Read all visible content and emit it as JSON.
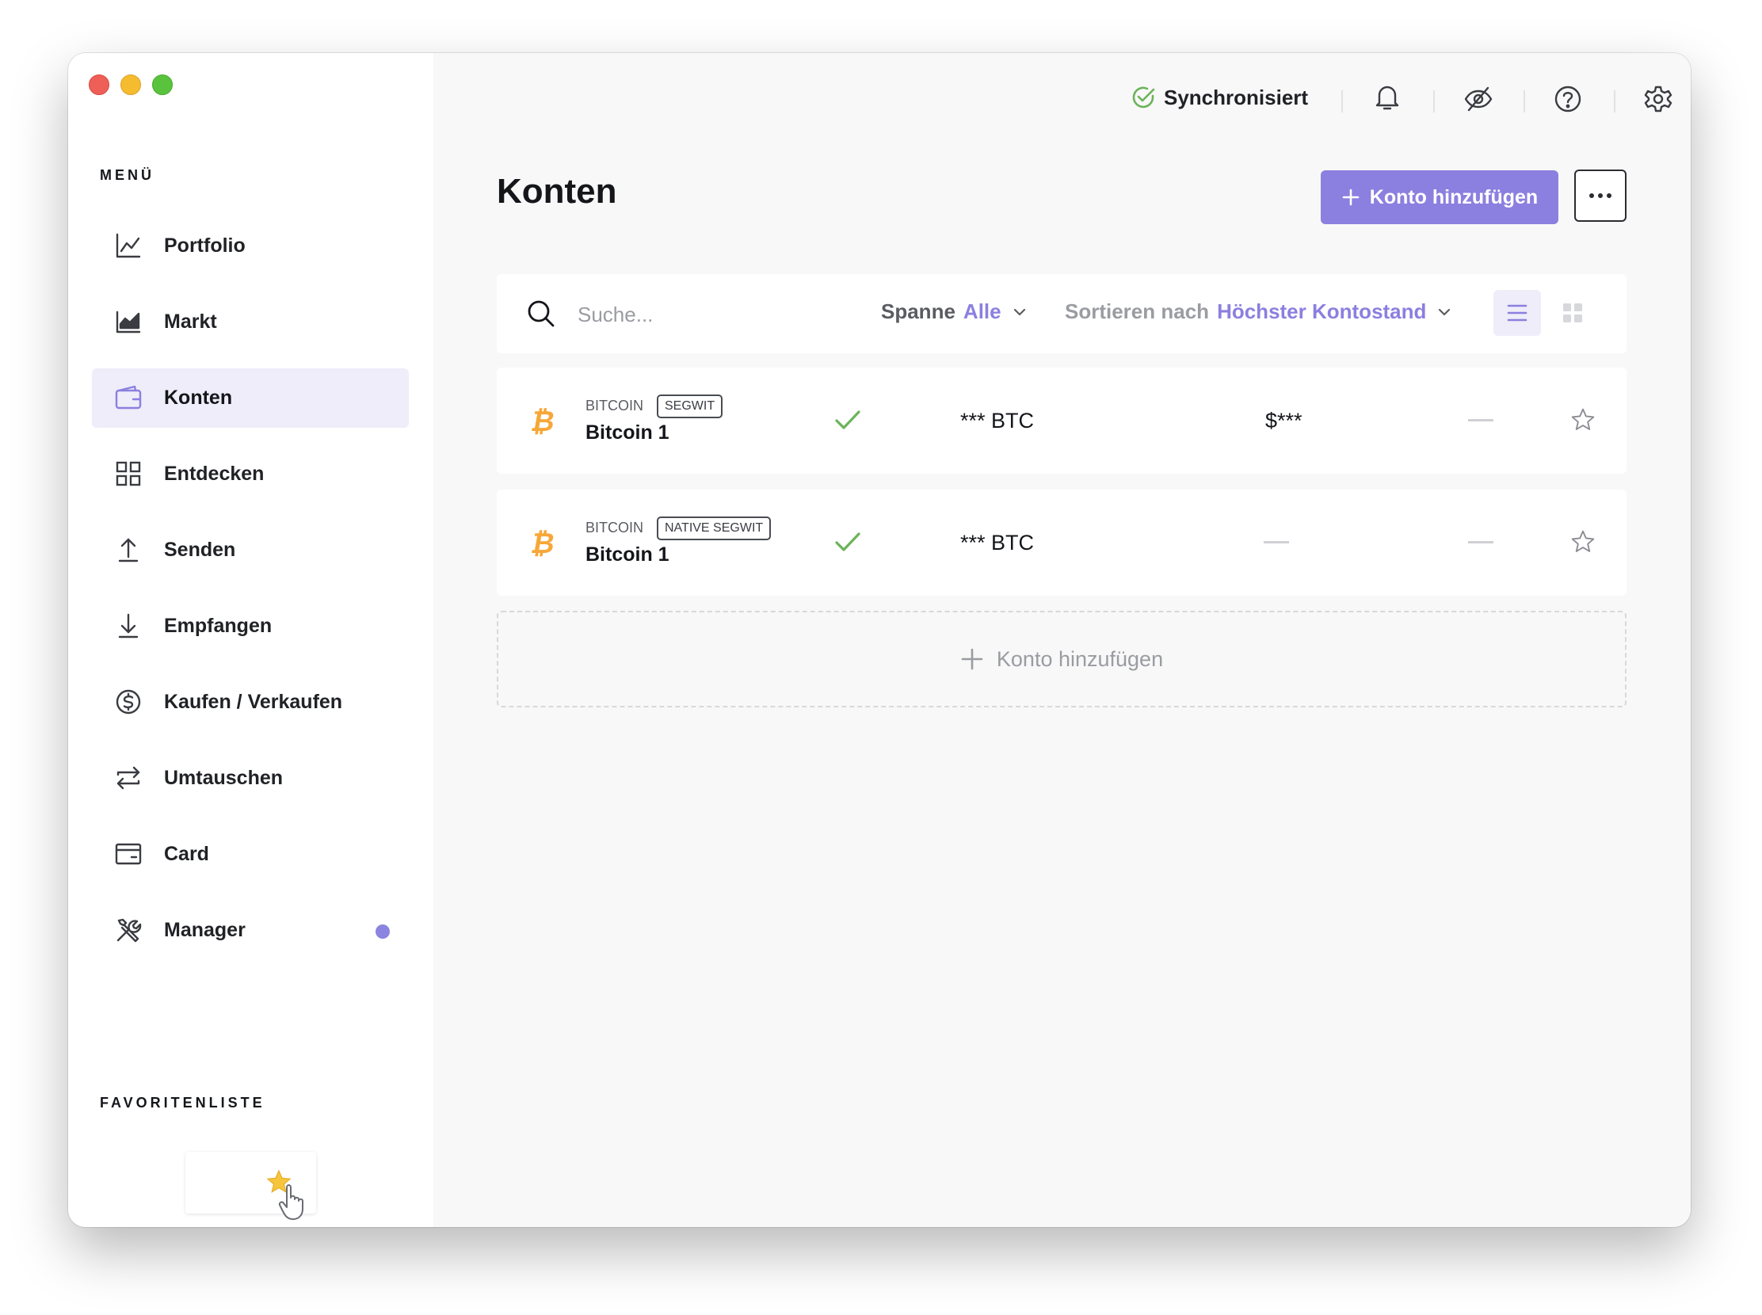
{
  "sidebar": {
    "menu_title": "MENÜ",
    "items": [
      {
        "label": "Portfolio",
        "icon": "chart-line-icon"
      },
      {
        "label": "Markt",
        "icon": "market-chart-icon"
      },
      {
        "label": "Konten",
        "icon": "wallet-icon",
        "active": true
      },
      {
        "label": "Entdecken",
        "icon": "grid-icon"
      },
      {
        "label": "Senden",
        "icon": "arrow-up-icon"
      },
      {
        "label": "Empfangen",
        "icon": "arrow-down-icon"
      },
      {
        "label": "Kaufen / Verkaufen",
        "icon": "dollar-circle-icon"
      },
      {
        "label": "Umtauschen",
        "icon": "swap-arrows-icon"
      },
      {
        "label": "Card",
        "icon": "card-icon"
      },
      {
        "label": "Manager",
        "icon": "tools-icon",
        "has_notification": true
      }
    ],
    "favorites_title": "FAVORITENLISTE"
  },
  "topbar": {
    "sync_label": "Synchronisiert",
    "icons": [
      "bell-icon",
      "eye-off-icon",
      "help-icon",
      "gear-icon"
    ]
  },
  "page": {
    "title": "Konten",
    "add_button_label": "Konto hinzufügen",
    "more_button_icon": "ellipsis-icon"
  },
  "toolbar": {
    "search_placeholder": "Suche...",
    "range_label": "Spanne",
    "range_value": "Alle",
    "sort_label": "Sortieren nach",
    "sort_value": "Höchster Kontostand"
  },
  "accounts": [
    {
      "family": "BITCOIN",
      "tag": "SEGWIT",
      "name": "Bitcoin 1",
      "balance": "*** BTC",
      "fiat": "$***",
      "synced": true
    },
    {
      "family": "BITCOIN",
      "tag": "NATIVE SEGWIT",
      "name": "Bitcoin 1",
      "balance": "*** BTC",
      "fiat": "",
      "synced": true
    }
  ],
  "add_account_label": "Konto hinzufügen",
  "colors": {
    "accent": "#8b7fe0",
    "active_bg": "#eeedf9",
    "bitcoin": "#f7a738",
    "success": "#6bb35a"
  }
}
